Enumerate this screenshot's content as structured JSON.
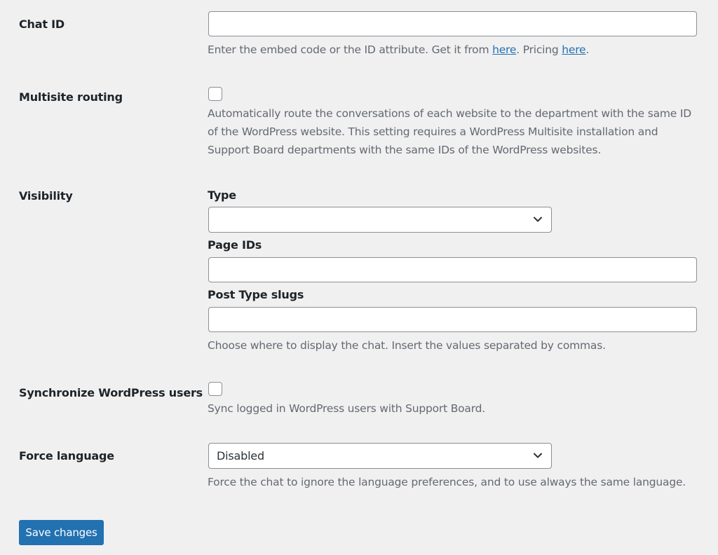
{
  "chat_id": {
    "label": "Chat ID",
    "value": "",
    "desc_prefix": "Enter the embed code or the ID attribute. Get it from ",
    "link1": "here",
    "desc_middle": ". Pricing ",
    "link2": "here",
    "desc_suffix": "."
  },
  "multisite": {
    "label": "Multisite routing",
    "checked": false,
    "desc_line1": "Automatically route the conversations of each website to the department with the same ID",
    "desc_line2": "of the WordPress website. This setting requires a WordPress Multisite installation and",
    "desc_line3": "Support Board departments with the same IDs of the WordPress websites."
  },
  "visibility": {
    "label": "Visibility",
    "type_label": "Type",
    "type_value": "",
    "page_ids_label": "Page IDs",
    "page_ids_value": "",
    "post_type_label": "Post Type slugs",
    "post_type_value": "",
    "desc": "Choose where to display the chat. Insert the values separated by commas."
  },
  "sync_users": {
    "label": "Synchronize WordPress users",
    "checked": false,
    "desc": "Sync logged in WordPress users with Support Board."
  },
  "force_language": {
    "label": "Force language",
    "value": "Disabled",
    "desc": "Force the chat to ignore the language preferences, and to use always the same language."
  },
  "save_label": "Save changes",
  "colors": {
    "primary": "#2271b1",
    "background": "#f0f0f1",
    "text": "#1d2327",
    "description": "#646970",
    "border": "#8c8f94"
  }
}
